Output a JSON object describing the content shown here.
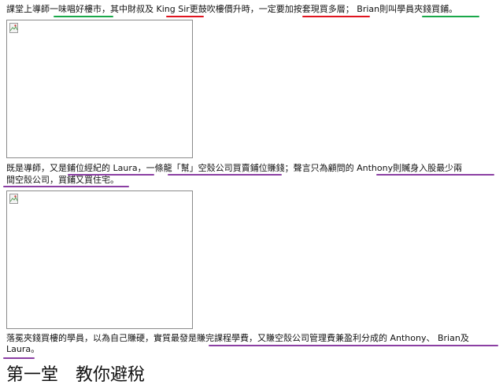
{
  "para1": {
    "s1": "課堂上導師",
    "s2": "一味唱好樓市",
    "s3": "，其中財叔及 ",
    "s4": "King Sir",
    "s5": "更鼓吹樓價升時，一定要",
    "s6": "加按套現買多層",
    "s7": "； Brian則叫",
    "s8": "學員夾錢買鋪",
    "s9": "。"
  },
  "para2": {
    "line1": {
      "s1": "既是導師，又是",
      "s2": "鋪位經紀的 Laura",
      "s3": "，",
      "s4": "一條龍「幫」空殼公司買賣鋪位賺錢",
      "s5": "；聲言只為顧問的 ",
      "s6": "Anthony則贓身入股最少兩"
    },
    "line2": {
      "s1": "間空殼公司",
      "s2": "，買鋪又買住宅。"
    }
  },
  "para3": {
    "line1": {
      "s1": "落冕夾錢買樓的學員，以為自己賺硬，實質最發是",
      "s2": "賺完課程學費，又賺空殼公司管理費兼盈利分成的 Anthony、 Brian及"
    },
    "line2": {
      "s1": "Laura",
      "s2": "。"
    }
  },
  "heading": "第一堂　教你避稅",
  "images": [
    {
      "alt": "",
      "icon": "broken-image-icon"
    },
    {
      "alt": "",
      "icon": "broken-image-icon"
    }
  ],
  "colors": {
    "green_underline": "#1aa84a",
    "red_underline": "#e0141f",
    "purple_underline": "#8b3fa3"
  }
}
